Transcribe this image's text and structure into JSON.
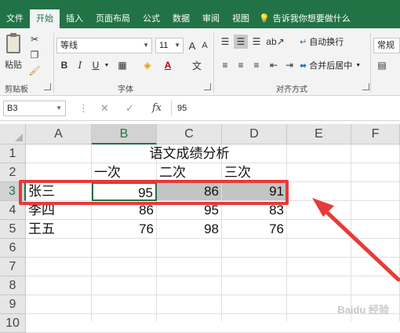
{
  "tabs": [
    "文件",
    "开始",
    "插入",
    "页面布局",
    "公式",
    "数据",
    "审阅",
    "视图"
  ],
  "active_tab_index": 1,
  "tell_me": "告诉我你想要做什么",
  "ribbon": {
    "clipboard": {
      "paste_label": "粘贴",
      "group_label": "剪贴板"
    },
    "font": {
      "font_name": "等线",
      "font_size": "11",
      "bold": "B",
      "italic": "I",
      "underline": "U",
      "phonetic": "文",
      "group_label": "字体"
    },
    "alignment": {
      "wrap_text": "自动换行",
      "merge_center": "合并后居中",
      "group_label": "对齐方式"
    },
    "number": {
      "format": "常规"
    }
  },
  "formula_bar": {
    "name_box": "B3",
    "cancel": "✕",
    "enter": "✓",
    "fx": "fx",
    "value": "95"
  },
  "sheet": {
    "columns": [
      "A",
      "B",
      "C",
      "D",
      "E",
      "F"
    ],
    "rows": [
      "1",
      "2",
      "3",
      "4",
      "5",
      "6",
      "7",
      "8",
      "9",
      "10"
    ],
    "title": "语文成绩分析",
    "headers": [
      "一次",
      "二次",
      "三次"
    ],
    "data": [
      {
        "name": "张三",
        "values": [
          "95",
          "86",
          "91"
        ]
      },
      {
        "name": "李四",
        "values": [
          "86",
          "95",
          "83"
        ]
      },
      {
        "name": "王五",
        "values": [
          "76",
          "98",
          "76"
        ]
      }
    ]
  },
  "colors": {
    "brand": "#217346",
    "annotation": "#e83a3a",
    "selection_fill": "#c4c4c4"
  },
  "watermark": "Baidu 经验"
}
